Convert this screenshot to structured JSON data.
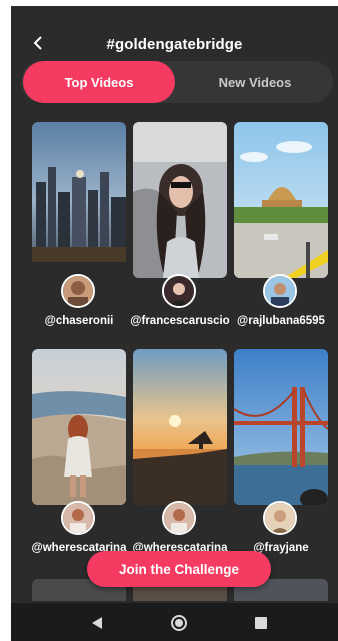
{
  "header": {
    "title": "#goldengatebridge",
    "back_icon": "chevron-left-icon"
  },
  "tabs": [
    {
      "label": "Top Videos",
      "active": true
    },
    {
      "label": "New Videos",
      "active": false
    }
  ],
  "videos": [
    {
      "username": "@chaseronii",
      "scene": "city-skyline"
    },
    {
      "username": "@francescaruscio",
      "scene": "woman-car"
    },
    {
      "username": "@rajlubana6595",
      "scene": "park-dome"
    },
    {
      "username": "@wherescatarina",
      "scene": "beach-woman"
    },
    {
      "username": "@wherescatarina",
      "scene": "sunset-coast"
    },
    {
      "username": "@frayjane",
      "scene": "golden-gate-bridge"
    }
  ],
  "cta": {
    "label": "Join the Challenge"
  },
  "navbar": {
    "icons": [
      "back-triangle-icon",
      "home-circle-icon",
      "recents-square-icon"
    ]
  },
  "colors": {
    "accent": "#f53b62",
    "background": "#2b2b2b",
    "tab_track": "#363636",
    "navbar": "#1b1b1b"
  }
}
